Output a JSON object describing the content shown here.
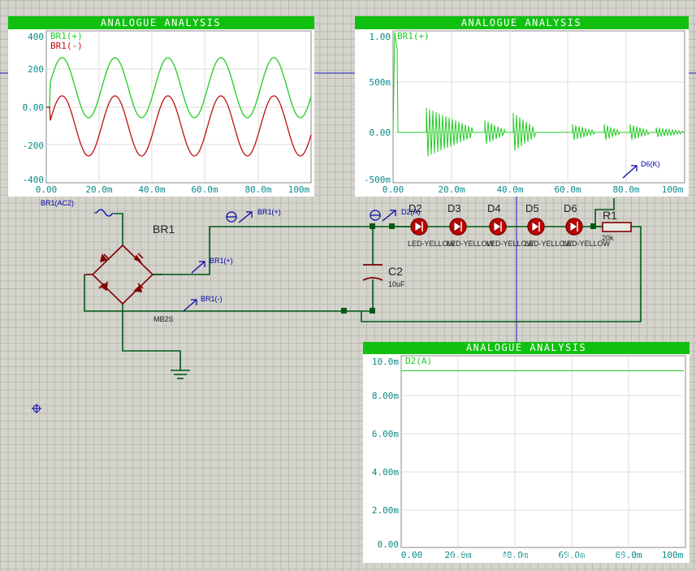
{
  "graphs": [
    {
      "title": "ANALOGUE ANALYSIS",
      "y_ticks": [
        "400",
        "200",
        "0.00",
        "-200",
        "-400"
      ],
      "x_ticks": [
        "0.00",
        "20.0m",
        "40.0m",
        "60.0m",
        "80.0m",
        "100m"
      ],
      "traces": [
        {
          "label": "BR1(+)",
          "color": "#22cc22"
        },
        {
          "label": "BR1(-)",
          "color": "#c01010"
        }
      ]
    },
    {
      "title": "ANALOGUE ANALYSIS",
      "y_ticks": [
        "1.00",
        "500m",
        "0.00",
        "-500m"
      ],
      "x_ticks": [
        "0.00",
        "20.0m",
        "40.0m",
        "60.0m",
        "80.0m",
        "100m"
      ],
      "traces": [
        {
          "label": "BR1(+)",
          "color": "#22cc22"
        }
      ]
    },
    {
      "title": "ANALOGUE ANALYSIS",
      "y_ticks": [
        "10.0m",
        "8.00m",
        "6.00m",
        "4.00m",
        "2.00m",
        "0.00"
      ],
      "x_ticks": [
        "0.00",
        "20.0m",
        "40.0m",
        "60.0m",
        "80.0m",
        "100m"
      ],
      "traces": [
        {
          "label": "D2(A)",
          "color": "#22cc22"
        }
      ]
    }
  ],
  "schematic": {
    "generator_label": "BR1(AC2)",
    "bridge_ref": "BR1",
    "bridge_value": "MB2S",
    "probe_bridge_plus": "BR1(+)",
    "probe_bridge_minus": "BR1(-)",
    "probe_top_plus": "BR1(+)",
    "probe_d2a": "D2(A)",
    "probe_d6k": "D6(K)",
    "cap_ref": "C2",
    "cap_value": "10uF",
    "resistor_ref": "R1",
    "resistor_value": "20k",
    "leds": [
      {
        "ref": "D2",
        "value": "LED-YELLOW"
      },
      {
        "ref": "D3",
        "value": "LED-YELLOW"
      },
      {
        "ref": "D4",
        "value": "LED-YELLOW"
      },
      {
        "ref": "D5",
        "value": "LED-YELLOW"
      },
      {
        "ref": "D6",
        "value": "LED-YELLOW"
      }
    ]
  },
  "watermark": "CSDN @geniuslwMRobot超级专家",
  "colors": {
    "wire": "#005a14",
    "component": "#800000",
    "probe": "#0000aa",
    "graph_title_bg": "#10c010",
    "axis_text": "#0a8a8a"
  }
}
